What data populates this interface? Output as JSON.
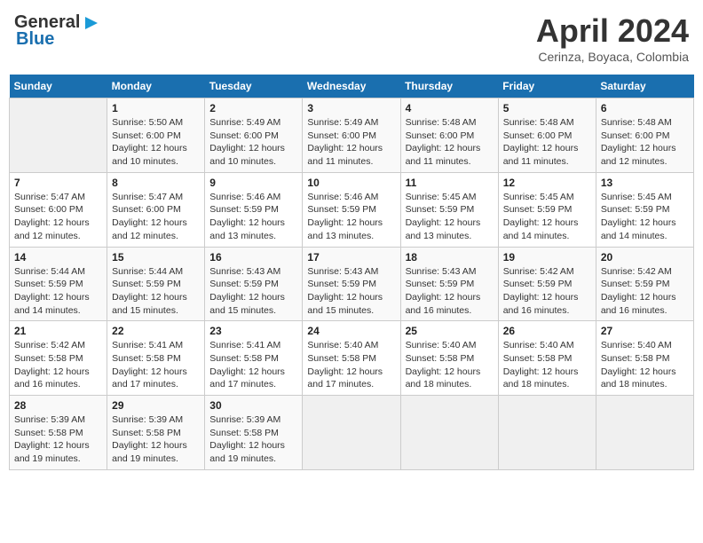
{
  "header": {
    "logo_line1": "General",
    "logo_line2": "Blue",
    "month": "April 2024",
    "location": "Cerinza, Boyaca, Colombia"
  },
  "days_of_week": [
    "Sunday",
    "Monday",
    "Tuesday",
    "Wednesday",
    "Thursday",
    "Friday",
    "Saturday"
  ],
  "weeks": [
    [
      {
        "day": "",
        "info": ""
      },
      {
        "day": "1",
        "info": "Sunrise: 5:50 AM\nSunset: 6:00 PM\nDaylight: 12 hours\nand 10 minutes."
      },
      {
        "day": "2",
        "info": "Sunrise: 5:49 AM\nSunset: 6:00 PM\nDaylight: 12 hours\nand 10 minutes."
      },
      {
        "day": "3",
        "info": "Sunrise: 5:49 AM\nSunset: 6:00 PM\nDaylight: 12 hours\nand 11 minutes."
      },
      {
        "day": "4",
        "info": "Sunrise: 5:48 AM\nSunset: 6:00 PM\nDaylight: 12 hours\nand 11 minutes."
      },
      {
        "day": "5",
        "info": "Sunrise: 5:48 AM\nSunset: 6:00 PM\nDaylight: 12 hours\nand 11 minutes."
      },
      {
        "day": "6",
        "info": "Sunrise: 5:48 AM\nSunset: 6:00 PM\nDaylight: 12 hours\nand 12 minutes."
      }
    ],
    [
      {
        "day": "7",
        "info": "Sunrise: 5:47 AM\nSunset: 6:00 PM\nDaylight: 12 hours\nand 12 minutes."
      },
      {
        "day": "8",
        "info": "Sunrise: 5:47 AM\nSunset: 6:00 PM\nDaylight: 12 hours\nand 12 minutes."
      },
      {
        "day": "9",
        "info": "Sunrise: 5:46 AM\nSunset: 5:59 PM\nDaylight: 12 hours\nand 13 minutes."
      },
      {
        "day": "10",
        "info": "Sunrise: 5:46 AM\nSunset: 5:59 PM\nDaylight: 12 hours\nand 13 minutes."
      },
      {
        "day": "11",
        "info": "Sunrise: 5:45 AM\nSunset: 5:59 PM\nDaylight: 12 hours\nand 13 minutes."
      },
      {
        "day": "12",
        "info": "Sunrise: 5:45 AM\nSunset: 5:59 PM\nDaylight: 12 hours\nand 14 minutes."
      },
      {
        "day": "13",
        "info": "Sunrise: 5:45 AM\nSunset: 5:59 PM\nDaylight: 12 hours\nand 14 minutes."
      }
    ],
    [
      {
        "day": "14",
        "info": "Sunrise: 5:44 AM\nSunset: 5:59 PM\nDaylight: 12 hours\nand 14 minutes."
      },
      {
        "day": "15",
        "info": "Sunrise: 5:44 AM\nSunset: 5:59 PM\nDaylight: 12 hours\nand 15 minutes."
      },
      {
        "day": "16",
        "info": "Sunrise: 5:43 AM\nSunset: 5:59 PM\nDaylight: 12 hours\nand 15 minutes."
      },
      {
        "day": "17",
        "info": "Sunrise: 5:43 AM\nSunset: 5:59 PM\nDaylight: 12 hours\nand 15 minutes."
      },
      {
        "day": "18",
        "info": "Sunrise: 5:43 AM\nSunset: 5:59 PM\nDaylight: 12 hours\nand 16 minutes."
      },
      {
        "day": "19",
        "info": "Sunrise: 5:42 AM\nSunset: 5:59 PM\nDaylight: 12 hours\nand 16 minutes."
      },
      {
        "day": "20",
        "info": "Sunrise: 5:42 AM\nSunset: 5:59 PM\nDaylight: 12 hours\nand 16 minutes."
      }
    ],
    [
      {
        "day": "21",
        "info": "Sunrise: 5:42 AM\nSunset: 5:58 PM\nDaylight: 12 hours\nand 16 minutes."
      },
      {
        "day": "22",
        "info": "Sunrise: 5:41 AM\nSunset: 5:58 PM\nDaylight: 12 hours\nand 17 minutes."
      },
      {
        "day": "23",
        "info": "Sunrise: 5:41 AM\nSunset: 5:58 PM\nDaylight: 12 hours\nand 17 minutes."
      },
      {
        "day": "24",
        "info": "Sunrise: 5:40 AM\nSunset: 5:58 PM\nDaylight: 12 hours\nand 17 minutes."
      },
      {
        "day": "25",
        "info": "Sunrise: 5:40 AM\nSunset: 5:58 PM\nDaylight: 12 hours\nand 18 minutes."
      },
      {
        "day": "26",
        "info": "Sunrise: 5:40 AM\nSunset: 5:58 PM\nDaylight: 12 hours\nand 18 minutes."
      },
      {
        "day": "27",
        "info": "Sunrise: 5:40 AM\nSunset: 5:58 PM\nDaylight: 12 hours\nand 18 minutes."
      }
    ],
    [
      {
        "day": "28",
        "info": "Sunrise: 5:39 AM\nSunset: 5:58 PM\nDaylight: 12 hours\nand 19 minutes."
      },
      {
        "day": "29",
        "info": "Sunrise: 5:39 AM\nSunset: 5:58 PM\nDaylight: 12 hours\nand 19 minutes."
      },
      {
        "day": "30",
        "info": "Sunrise: 5:39 AM\nSunset: 5:58 PM\nDaylight: 12 hours\nand 19 minutes."
      },
      {
        "day": "",
        "info": ""
      },
      {
        "day": "",
        "info": ""
      },
      {
        "day": "",
        "info": ""
      },
      {
        "day": "",
        "info": ""
      }
    ]
  ]
}
